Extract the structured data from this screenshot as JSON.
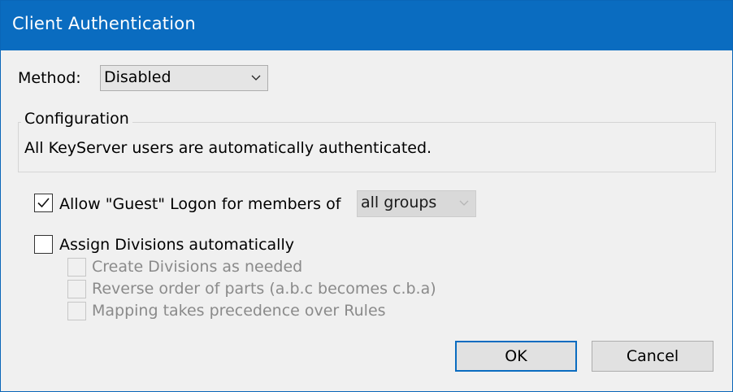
{
  "window": {
    "title": "Client Authentication"
  },
  "method": {
    "label": "Method:",
    "selected": "Disabled"
  },
  "configuration": {
    "legend": "Configuration",
    "text": "All KeyServer users are automatically authenticated."
  },
  "guest_logon": {
    "label": "Allow \"Guest\" Logon for members of",
    "checked": true,
    "group_selected": "all groups"
  },
  "divisions": {
    "label": "Assign Divisions automatically",
    "checked": false,
    "options": [
      {
        "label": "Create Divisions as needed",
        "checked": false,
        "enabled": false
      },
      {
        "label": "Reverse order of parts (a.b.c becomes c.b.a)",
        "checked": false,
        "enabled": false
      },
      {
        "label": "Mapping takes precedence over Rules",
        "checked": false,
        "enabled": false
      }
    ]
  },
  "buttons": {
    "ok": "OK",
    "cancel": "Cancel"
  },
  "colors": {
    "titlebar": "#0a6cc0",
    "default_button_border": "#0a6cc0"
  }
}
